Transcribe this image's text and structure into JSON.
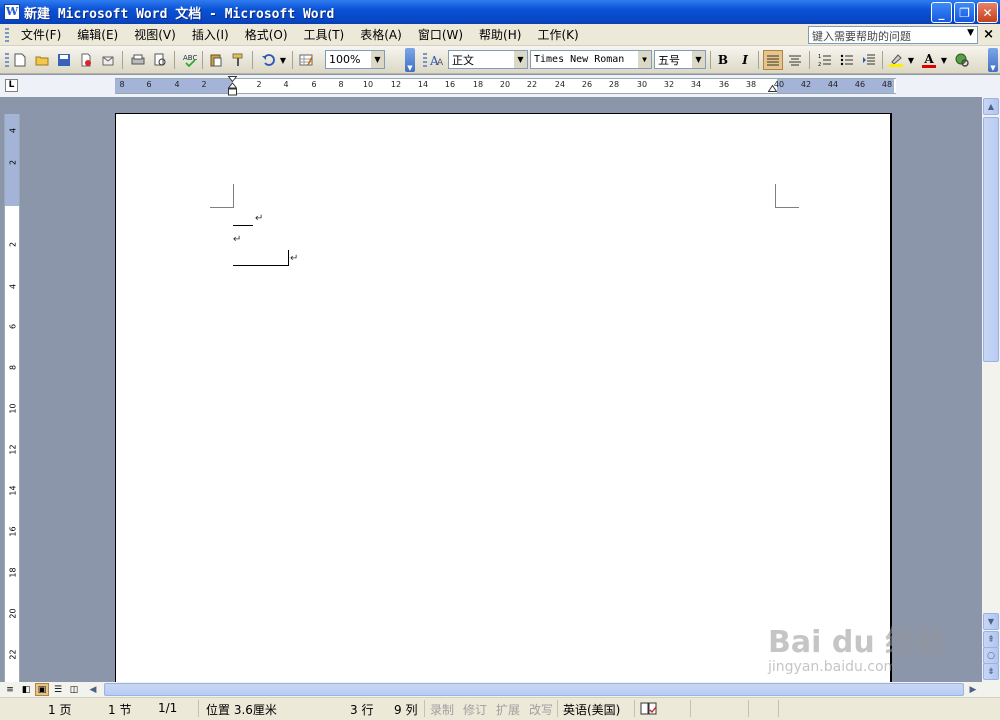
{
  "window": {
    "title": "新建 Microsoft Word 文档 - Microsoft Word",
    "app_icon_letter": "W",
    "minimize": "_",
    "restore": "❐",
    "close": "✕"
  },
  "menubar": {
    "items": [
      "文件(F)",
      "编辑(E)",
      "视图(V)",
      "插入(I)",
      "格式(O)",
      "工具(T)",
      "表格(A)",
      "窗口(W)",
      "帮助(H)",
      "工作(K)"
    ],
    "help_placeholder": "键入需要帮助的问题",
    "close": "×"
  },
  "toolbar": {
    "zoom": "100%",
    "style": "正文",
    "font": "Times New Roman",
    "size": "五号",
    "bold": "B",
    "italic": "I",
    "font_color": "A"
  },
  "ruler": {
    "tab_selector": "L",
    "left_labels": [
      "8",
      "6",
      "4",
      "2"
    ],
    "right_labels": [
      "2",
      "4",
      "6",
      "8",
      "10",
      "12",
      "14",
      "16",
      "18",
      "20",
      "22",
      "24",
      "26",
      "28",
      "30",
      "32",
      "34",
      "36",
      "38",
      "40",
      "42",
      "44",
      "46",
      "48"
    ],
    "vertical_labels": [
      "4",
      "2",
      "2",
      "4",
      "6",
      "8",
      "10",
      "12",
      "14",
      "16",
      "18",
      "20",
      "22"
    ]
  },
  "document": {
    "paragraph_mark": "↵"
  },
  "statusbar": {
    "page": "1 页",
    "section": "1 节",
    "page_of": "1/1",
    "position": "位置 3.6厘米",
    "line": "3 行",
    "column": "9 列",
    "rec": "录制",
    "trk": "修订",
    "ext": "扩展",
    "ovr": "改写",
    "language": "英语(美国)"
  },
  "watermark": {
    "brand": "Bai du 经验",
    "url": "jingyan.baidu.com"
  },
  "colors": {
    "titlebar": "#0a52d6",
    "chrome": "#ece9d8",
    "workspace": "#8c96aa",
    "ruler_margin": "#a4b3d8"
  }
}
